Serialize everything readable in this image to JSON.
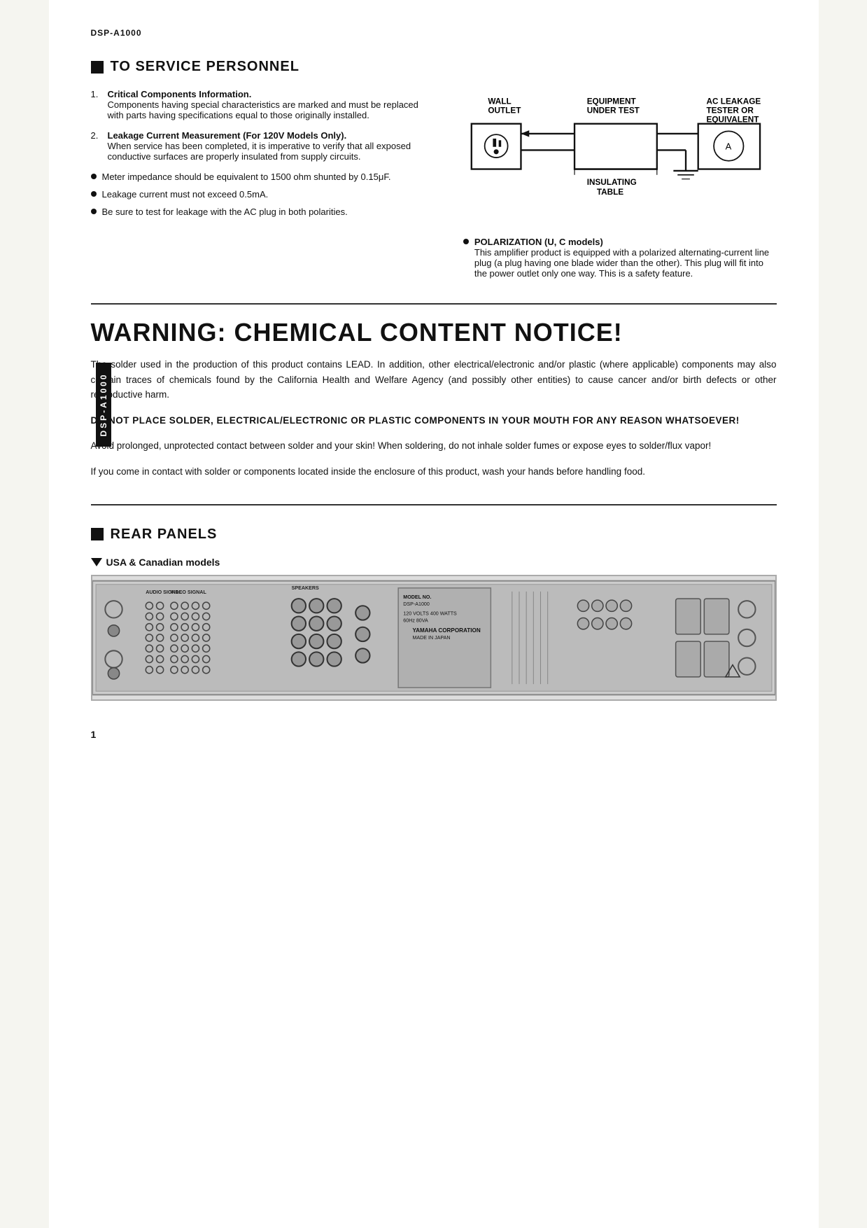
{
  "model": "DSP-A1000",
  "to_service_personnel": {
    "title": "TO SERVICE PERSONNEL",
    "items": [
      {
        "number": "1.",
        "text": "Critical Components Information.\nComponents having special characteristics are marked and must be replaced with parts having specifications equal to those originally installed."
      },
      {
        "number": "2.",
        "text": "Leakage Current Measurement (For 120V Models Only).\nWhen service has been completed, it is imperative to verify that all exposed conductive surfaces are properly insulated from supply circuits."
      }
    ],
    "bullets": [
      "Meter impedance should be equivalent to 1500 ohm shunted by 0.15μF.",
      "Leakage current must not exceed 0.5mA.",
      "Be sure to test for leakage with the AC plug in both polarities."
    ]
  },
  "diagram": {
    "wall_outlet_label": "WALL\nOUTLET",
    "equipment_label": "EQUIPMENT\nUNDER TEST",
    "ac_leakage_label": "AC LEAKAGE\nTESTER OR\nEQUIVALENT",
    "insulating_label": "INSULATING\nTABLE"
  },
  "polarization": {
    "title": "POLARIZATION (U, C models)",
    "text": "This amplifier product is equipped with a polarized alternating-current line plug (a plug having one blade wider than the other). This plug will fit into the power outlet only one way. This is a safety feature."
  },
  "warning": {
    "title": "WARNING: CHEMICAL CONTENT NOTICE!",
    "paragraphs": [
      "The solder used in the production of this product contains LEAD. In addition, other electrical/electronic and/or plastic (where applicable) components may also contain traces of chemicals found by the California Health and Welfare Agency (and possibly other entities) to cause cancer and/or birth defects or other reproductive harm.",
      "DO NOT PLACE SOLDER, ELECTRICAL/ELECTRONIC OR PLASTIC COMPONENTS IN YOUR MOUTH FOR ANY REASON WHATSOEVER!",
      "Avoid prolonged, unprotected contact between solder and your skin! When soldering, do not inhale solder fumes or expose eyes to solder/flux vapor!",
      "If you come in contact with solder or components located inside the enclosure of this product, wash your hands before handling food."
    ],
    "sidebar_label": "DSP-A1000"
  },
  "rear_panels": {
    "title": "REAR PANELS",
    "subsection": "USA & Canadian models"
  },
  "page_number": "1"
}
